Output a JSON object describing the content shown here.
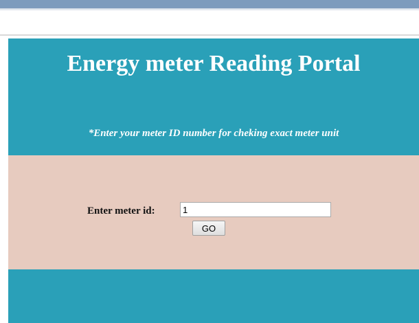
{
  "header": {
    "title": "Energy meter Reading Portal",
    "subtitle": "*Enter your meter ID number for cheking exact meter unit"
  },
  "form": {
    "meter_id_label": "Enter meter id:",
    "meter_id_value": "1",
    "go_button_label": "GO"
  },
  "colors": {
    "panel_teal": "#2aa0b8",
    "form_background": "#e7cbbf",
    "title_text": "#ffffff"
  }
}
